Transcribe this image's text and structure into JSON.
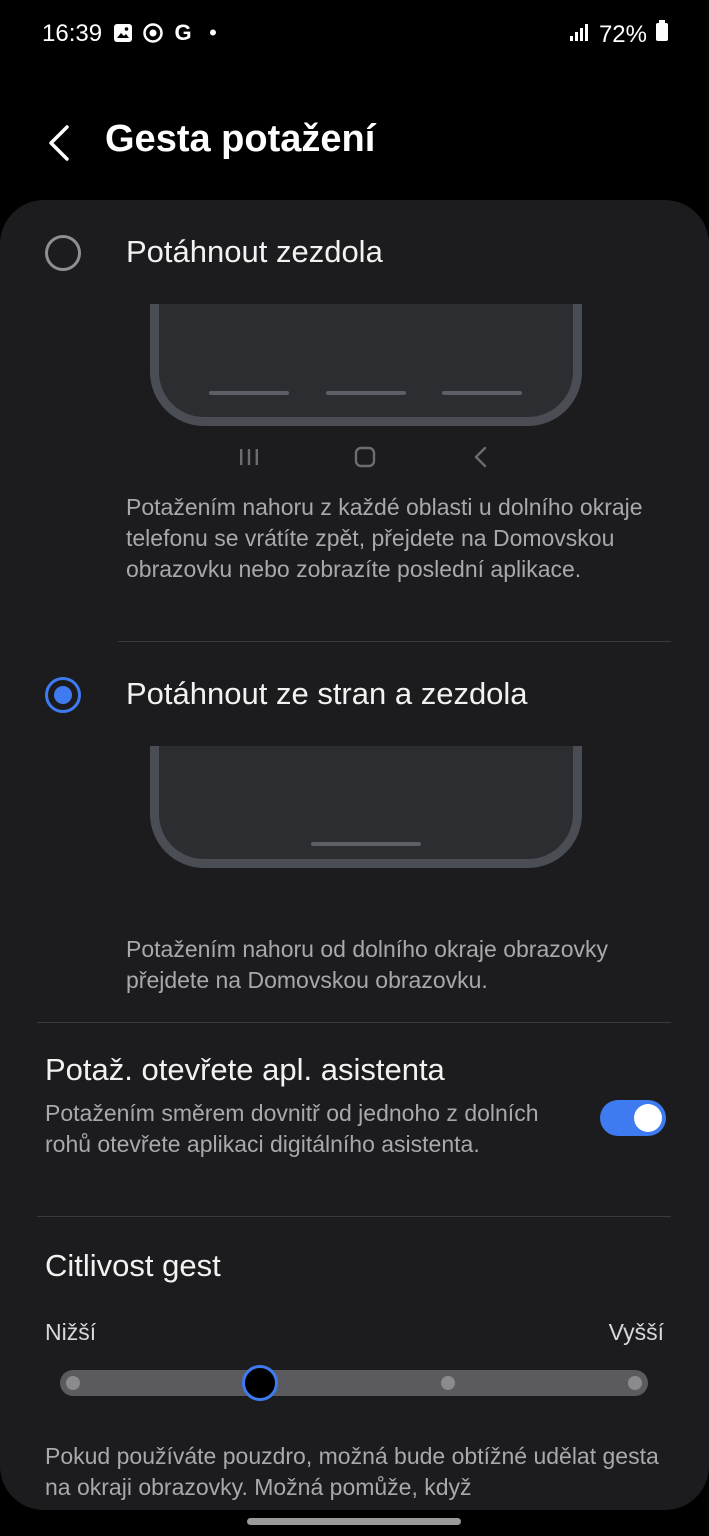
{
  "status_bar": {
    "time": "16:39",
    "battery": "72%",
    "notification_icons": [
      "gallery-icon",
      "target-icon",
      "google-icon",
      "dot-icon"
    ],
    "notif_more": "•",
    "google_letter": "G"
  },
  "header": {
    "title": "Gesta potažení"
  },
  "options": [
    {
      "label": "Potáhnout zezdola",
      "selected": false,
      "description": "Potažením nahoru z každé oblasti u dolního okraje telefonu se vrátíte zpět, přejdete na Domovskou obrazovku nebo zobrazíte poslední aplikace.",
      "nav_icons": [
        "recents-icon",
        "home-icon",
        "back-icon"
      ]
    },
    {
      "label": "Potáhnout ze stran a zezdola",
      "selected": true,
      "description": "Potažením nahoru od dolního okraje obrazovky přejdete na Domovskou obrazovku."
    }
  ],
  "assistant": {
    "title": "Potaž. otevřete apl. asistenta",
    "description": "Potažením směrem dovnitř od jednoho z dolních rohů otevřete aplikaci digitálního asistenta.",
    "enabled": true
  },
  "sensitivity": {
    "title": "Citlivost gest",
    "min_label": "Nižší",
    "max_label": "Vyšší",
    "steps": 4,
    "value_index": 1
  },
  "footer_note": "Pokud používáte pouzdro, možná bude obtížné udělat gesta na okraji obrazovky. Možná pomůže, když",
  "colors": {
    "accent": "#3e7bf0",
    "card_bg": "#1c1c1e",
    "background": "#000000"
  }
}
